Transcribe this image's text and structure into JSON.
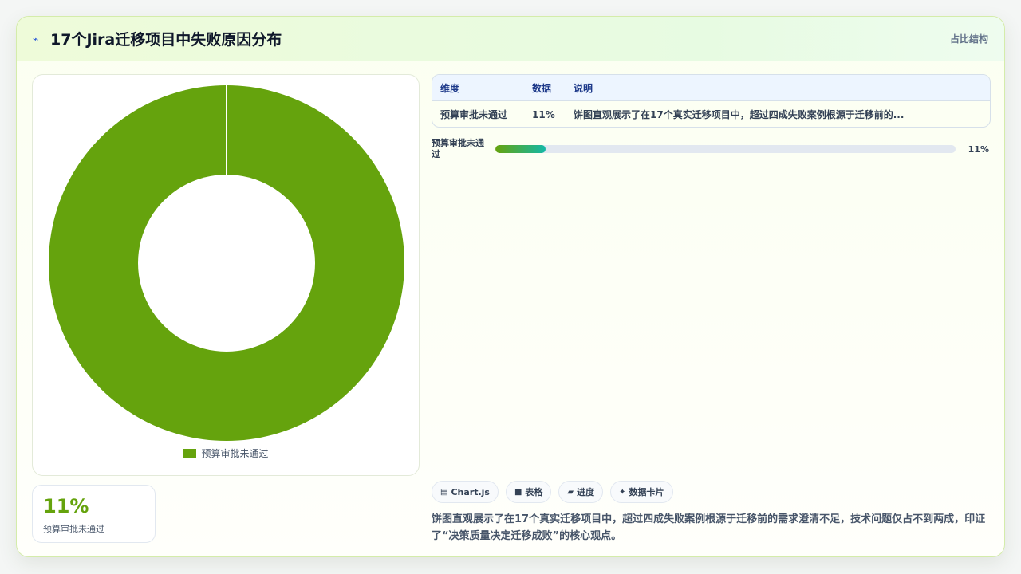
{
  "header": {
    "icon": "sparkline-icon",
    "title": "17个Jira迁移项目中失败原因分布",
    "tag": "占比结构"
  },
  "chart_data": {
    "type": "pie",
    "title": "17个Jira迁移项目中失败原因分布",
    "categories": [
      "预算审批未通过"
    ],
    "values": [
      11
    ],
    "unit": "%",
    "donut": true,
    "colors": [
      "#65a30d"
    ],
    "legend_position": "bottom"
  },
  "stat": {
    "value": "11%",
    "label": "预算审批未通过"
  },
  "table": {
    "headers": [
      "维度",
      "数据",
      "说明"
    ],
    "rows": [
      [
        "预算审批未通过",
        "11%",
        "饼图直观展示了在17个真实迁移项目中，超过四成失败案例根源于迁移前的..."
      ]
    ]
  },
  "progress": [
    {
      "label": "预算审批未通过",
      "value": 11,
      "value_label": "11%"
    }
  ],
  "chips": [
    {
      "icon": "chart-icon",
      "glyph": "▤",
      "label": "Chart.js"
    },
    {
      "icon": "table-icon",
      "glyph": "■",
      "label": "表格"
    },
    {
      "icon": "progress-icon",
      "glyph": "▰",
      "label": "进度"
    },
    {
      "icon": "sparkle-icon",
      "glyph": "✦",
      "label": "数据卡片"
    }
  ],
  "description": "饼图直观展示了在17个真实迁移项目中，超过四成失败案例根源于迁移前的需求澄清不足，技术问题仅占不到两成，印证了“决策质量决定迁移成败”的核心观点。"
}
